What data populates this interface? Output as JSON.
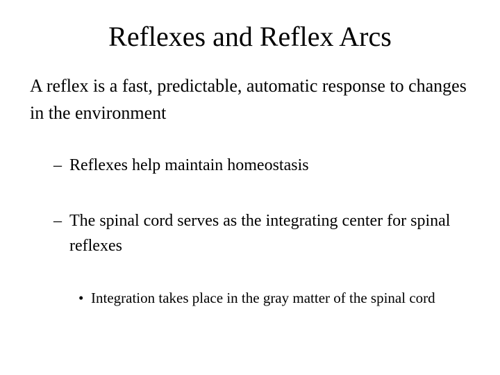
{
  "slide": {
    "title": "Reflexes and Reflex Arcs",
    "background_color": "#ffffff",
    "text_color": "#000000",
    "bullets": [
      {
        "level": 1,
        "marker": "",
        "text": "A reflex is a fast, predictable, automatic response to changes in the environment"
      },
      {
        "level": 2,
        "marker": "–",
        "text": "Reflexes help maintain homeostasis"
      },
      {
        "level": 2,
        "marker": "–",
        "text": "The spinal cord serves as the integrating center for spinal reflexes"
      },
      {
        "level": 3,
        "marker": "•",
        "text": "Integration takes place in the gray matter of the spinal cord"
      }
    ]
  }
}
